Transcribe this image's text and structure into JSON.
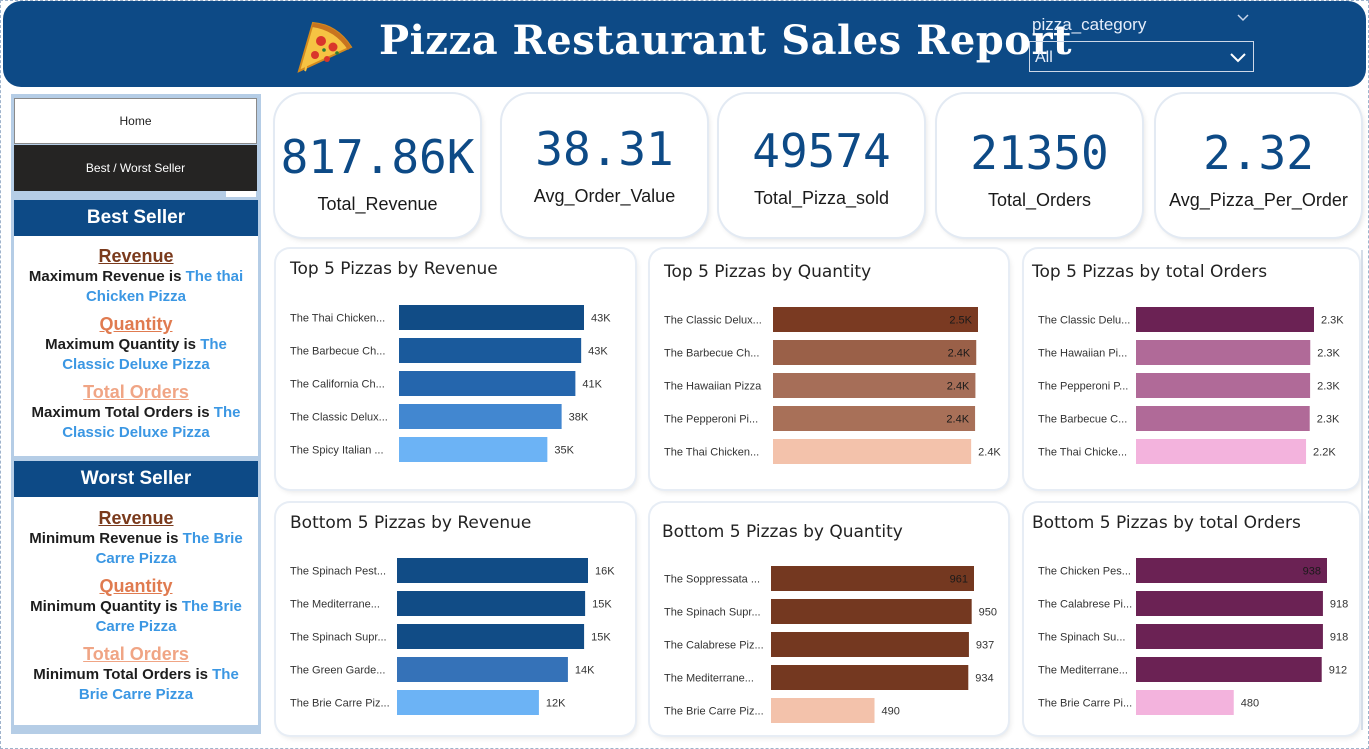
{
  "header": {
    "title": "Pizza Restaurant Sales Report",
    "icon": "pizza-slice-icon",
    "filter_label": "pizza_category",
    "filter_value": "All"
  },
  "nav": {
    "home": "Home",
    "best_worst": "Best / Worst Seller"
  },
  "best_seller": {
    "heading": "Best Seller",
    "revenue_title": "Revenue",
    "revenue_label": "Maximum Revenue is ",
    "revenue_value": "The thai Chicken Pizza",
    "quantity_title": "Quantity",
    "quantity_label": "Maximum Quantity is ",
    "quantity_value": "The Classic Deluxe Pizza",
    "orders_title": "Total Orders",
    "orders_label": "Maximum Total Orders is ",
    "orders_value": "The Classic Deluxe Pizza"
  },
  "worst_seller": {
    "heading": "Worst Seller",
    "revenue_title": "Revenue",
    "revenue_label": "Minimum Revenue is ",
    "revenue_value": "The Brie Carre Pizza",
    "quantity_title": "Quantity",
    "quantity_label": "Minimum Quantity is ",
    "quantity_value": "The Brie Carre Pizza",
    "orders_title": "Total Orders",
    "orders_label": "Minimum Total Orders is ",
    "orders_value": "The Brie Carre Pizza"
  },
  "kpis": [
    {
      "value": "817.86K",
      "label": "Total_Revenue"
    },
    {
      "value": "38.31",
      "label": "Avg_Order_Value"
    },
    {
      "value": "49574",
      "label": "Total_Pizza_sold"
    },
    {
      "value": "21350",
      "label": "Total_Orders"
    },
    {
      "value": "2.32",
      "label": "Avg_Pizza_Per_Order"
    }
  ],
  "colors": {
    "header": "#0d4a86",
    "accent_blue": "#3b97e3",
    "revenue_title": "#7a3a1c",
    "quantity_title": "#e07b50",
    "orders_title": "#f0a585"
  },
  "chart_data": [
    {
      "type": "bar",
      "title": "Top 5 Pizzas by Revenue",
      "categories": [
        "The Thai Chicken...",
        "The Barbecue Ch...",
        "The California Ch...",
        "The Classic Delux...",
        "The Spicy Italian ..."
      ],
      "values": [
        43434,
        42768,
        41410,
        38180,
        34831
      ],
      "labels": [
        "43K",
        "43K",
        "41K",
        "38K",
        "35K"
      ],
      "colors": [
        "#114c86",
        "#1a5a9c",
        "#2566ad",
        "#4287d0",
        "#6cb3f5"
      ]
    },
    {
      "type": "bar",
      "title": "Top 5 Pizzas by Quantity",
      "categories": [
        "The Classic Delux...",
        "The Barbecue Ch...",
        "The Hawaiian Pizza",
        "The Pepperoni Pi...",
        "The Thai Chicken..."
      ],
      "values": [
        2453,
        2432,
        2422,
        2418,
        2371
      ],
      "labels": [
        "2.5K",
        "2.4K",
        "2.4K",
        "2.4K",
        "2.4K"
      ],
      "colors": [
        "#7a3a22",
        "#9a6048",
        "#a66e58",
        "#a87058",
        "#f3c2ab"
      ]
    },
    {
      "type": "bar",
      "title": "Top 5 Pizzas by total Orders",
      "categories": [
        "The Classic Delu...",
        "The Hawaiian Pi...",
        "The Pepperoni P...",
        "The Barbecue C...",
        "The Thai Chicke..."
      ],
      "values": [
        2329,
        2280,
        2278,
        2273,
        2225
      ],
      "labels": [
        "2.3K",
        "2.3K",
        "2.3K",
        "2.3K",
        "2.2K"
      ],
      "colors": [
        "#6b2254",
        "#b06a98",
        "#b06a98",
        "#b06a98",
        "#f3b3dd"
      ]
    },
    {
      "type": "bar",
      "title": "Bottom 5 Pizzas by Revenue",
      "categories": [
        "The Spinach Pest...",
        "The Mediterrane...",
        "The Spinach Supr...",
        "The Green Garde...",
        "The Brie Carre Piz..."
      ],
      "values": [
        15596,
        15360,
        15277,
        13956,
        11588
      ],
      "labels": [
        "16K",
        "15K",
        "15K",
        "14K",
        "12K"
      ],
      "colors": [
        "#114c86",
        "#114c86",
        "#114c86",
        "#3572b8",
        "#6cb3f5"
      ]
    },
    {
      "type": "bar",
      "title": "Bottom 5 Pizzas by Quantity",
      "categories": [
        "The Soppressata ...",
        "The Spinach Supr...",
        "The Calabrese Piz...",
        "The Mediterrane...",
        "The Brie Carre Piz..."
      ],
      "values": [
        961,
        950,
        937,
        934,
        490
      ],
      "labels": [
        "961",
        "950",
        "937",
        "934",
        "490"
      ],
      "colors": [
        "#743820",
        "#743820",
        "#743820",
        "#743820",
        "#f3c2ab"
      ]
    },
    {
      "type": "bar",
      "title": "Bottom 5 Pizzas by total Orders",
      "categories": [
        "The Chicken Pes...",
        "The Calabrese Pi...",
        "The Spinach Su...",
        "The Mediterrane...",
        "The Brie Carre Pi..."
      ],
      "values": [
        938,
        918,
        918,
        912,
        480
      ],
      "labels": [
        "938",
        "918",
        "918",
        "912",
        "480"
      ],
      "colors": [
        "#6b2254",
        "#6b2254",
        "#6b2254",
        "#6b2254",
        "#f3b3dd"
      ]
    }
  ]
}
